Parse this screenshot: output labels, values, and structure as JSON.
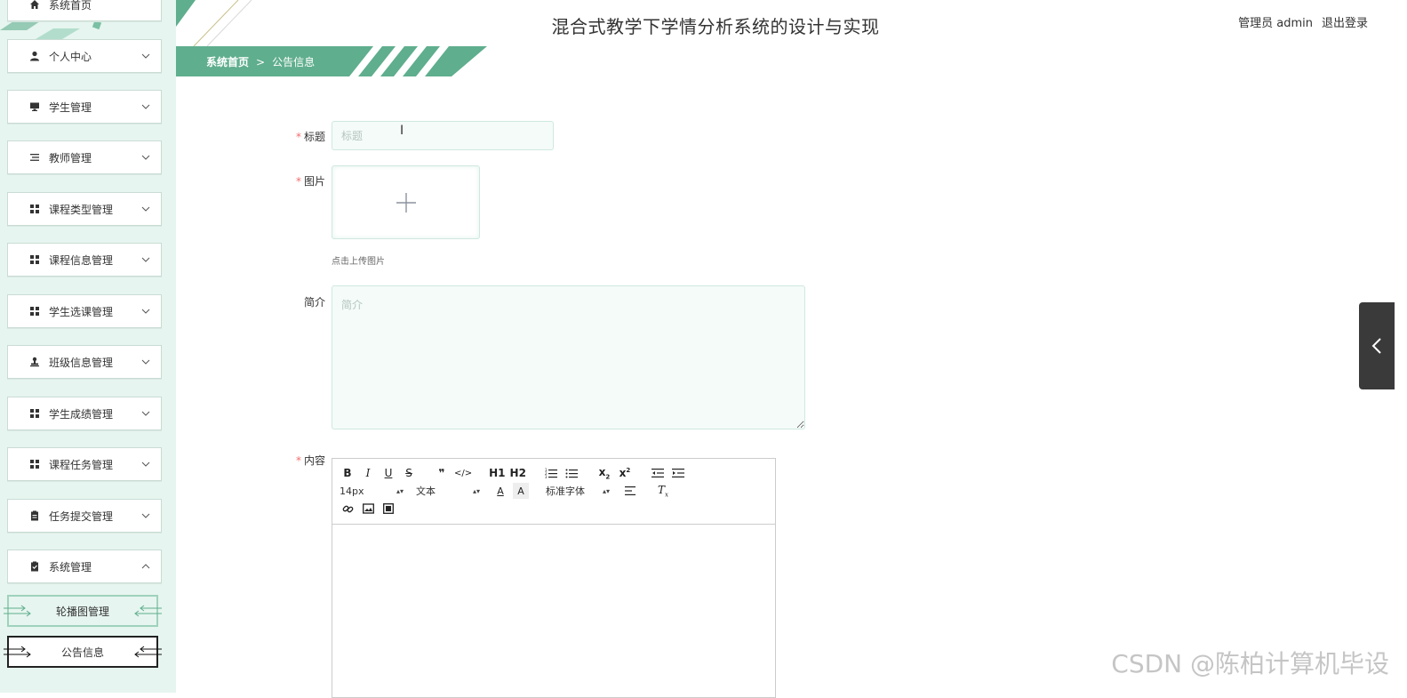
{
  "app_title": "混合式教学下学情分析系统的设计与实现",
  "user": {
    "role_name": "管理员 admin",
    "logout_label": "退出登录"
  },
  "breadcrumb": {
    "home": "系统首页",
    "separator": ">",
    "current": "公告信息"
  },
  "sidebar": {
    "items": [
      {
        "label": "系统首页",
        "icon": "home-icon"
      },
      {
        "label": "个人中心",
        "icon": "user-icon"
      },
      {
        "label": "学生管理",
        "icon": "monitor-icon"
      },
      {
        "label": "教师管理",
        "icon": "list-icon"
      },
      {
        "label": "课程类型管理",
        "icon": "grid-icon"
      },
      {
        "label": "课程信息管理",
        "icon": "grid-icon"
      },
      {
        "label": "学生选课管理",
        "icon": "grid-icon"
      },
      {
        "label": "班级信息管理",
        "icon": "stamp-icon"
      },
      {
        "label": "学生成绩管理",
        "icon": "grid-icon"
      },
      {
        "label": "课程任务管理",
        "icon": "grid-icon"
      },
      {
        "label": "任务提交管理",
        "icon": "clipboard-icon"
      },
      {
        "label": "系统管理",
        "icon": "clipboard-check-icon",
        "expanded": true
      }
    ],
    "sub_items": [
      {
        "label": "轮播图管理",
        "active": false
      },
      {
        "label": "公告信息",
        "active": true
      }
    ]
  },
  "form": {
    "title": {
      "label": "标题",
      "required": true,
      "placeholder": "标题",
      "value": ""
    },
    "image": {
      "label": "图片",
      "required": true,
      "hint": "点击上传图片"
    },
    "intro": {
      "label": "简介",
      "required": false,
      "placeholder": "简介",
      "value": ""
    },
    "content": {
      "label": "内容",
      "required": true
    }
  },
  "editor": {
    "row1": [
      "B",
      "I",
      "U",
      "S",
      "❞",
      "</>",
      "H1",
      "H2",
      "ordered-list-icon",
      "bullet-list-icon",
      "subscript-icon",
      "superscript-icon",
      "outdent-icon",
      "indent-icon"
    ],
    "font_size": "14px",
    "header_select": "文本",
    "font_family": "标准字体",
    "row3": [
      "link-icon",
      "image-icon",
      "video-icon"
    ]
  },
  "watermark": "CSDN @陈柏计算机毕设",
  "colors": {
    "accent": "#5fae8e",
    "sidebar_bg": "#e6f5ef",
    "required": "#f56c6c"
  }
}
